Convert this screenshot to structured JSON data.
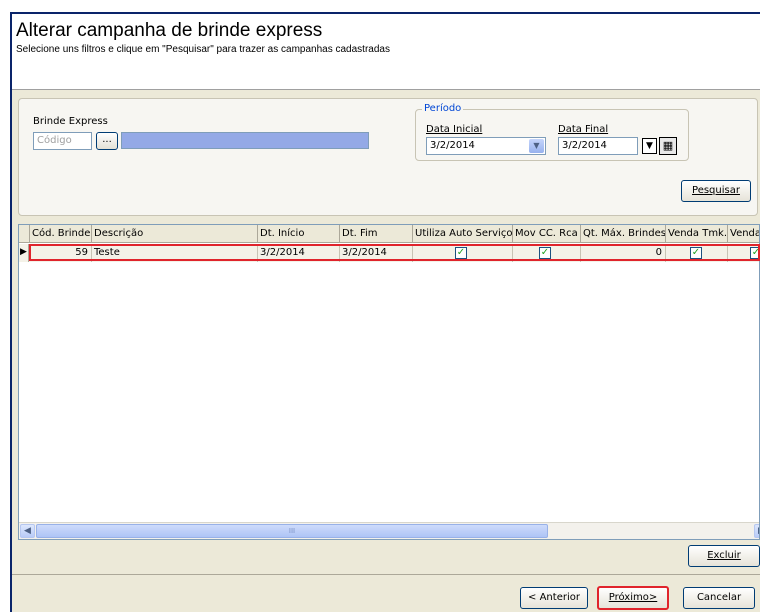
{
  "header": {
    "title": "Alterar campanha de brinde express",
    "subtitle": "Selecione uns filtros e clique em \"Pesquisar\" para trazer as campanhas cadastradas"
  },
  "filters": {
    "brinde_label": "Brinde Express",
    "codigo_placeholder": "Código",
    "lookup_label": "...",
    "periodo_legend": "Período",
    "data_inicial_label": "Data Inicial",
    "data_inicial_value": "3/2/2014",
    "data_final_label": "Data Final",
    "data_final_value": "3/2/2014",
    "pesquisar_label": "Pesquisar"
  },
  "grid": {
    "columns": [
      "Cód. Brinde",
      "Descrição",
      "Dt. Início",
      "Dt. Fim",
      "Utiliza Auto Serviço",
      "Mov CC. Rca",
      "Qt. Máx. Brindes",
      "Venda Tmk.",
      "Venda"
    ],
    "rows": [
      {
        "codigo": "59",
        "descricao": "Teste",
        "dt_inicio": "3/2/2014",
        "dt_fim": "3/2/2014",
        "auto_servico": true,
        "mov_cc_rca": true,
        "qt_max": "0",
        "venda_tmk": true,
        "venda": true
      }
    ],
    "scroll_grip": "III"
  },
  "buttons": {
    "excluir": "Excluir",
    "anterior": "< Anterior",
    "proximo": "Próximo>",
    "cancelar": "Cancelar"
  },
  "colors": {
    "highlight": "#e0242c",
    "selection": "#94a9e6",
    "check": "#21a121"
  }
}
